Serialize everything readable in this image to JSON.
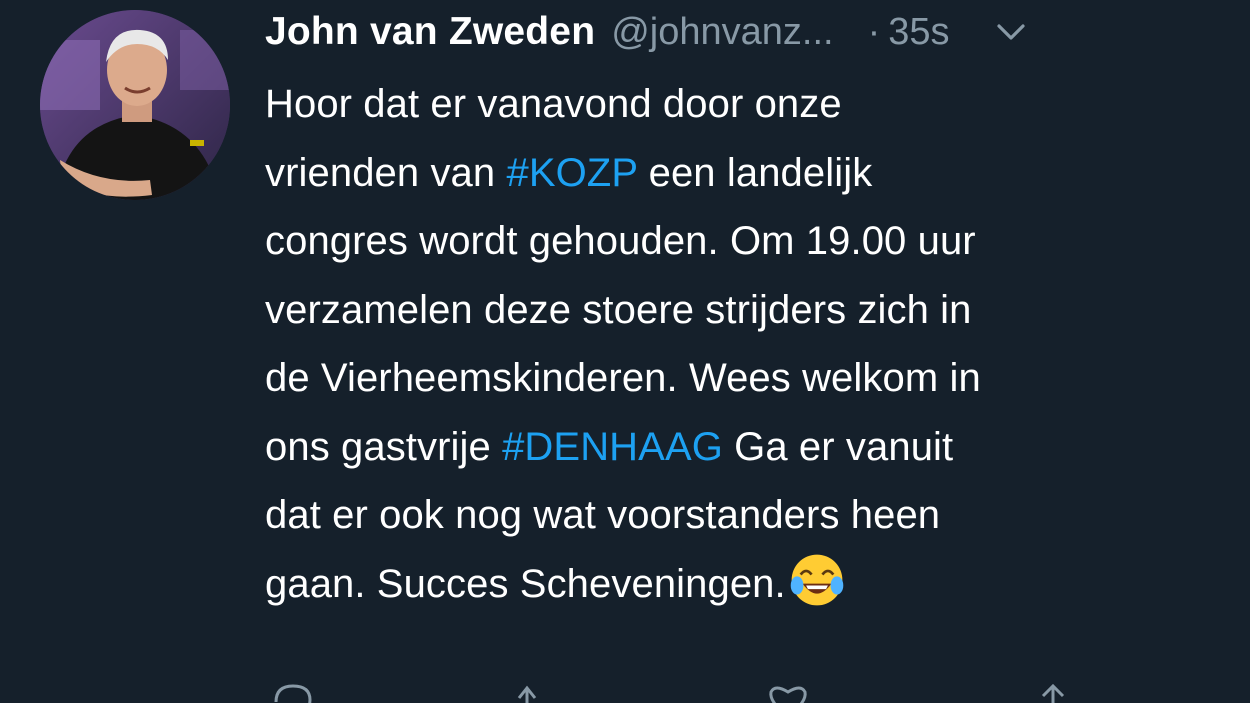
{
  "tweet": {
    "author_name": "John van Zweden",
    "author_handle": "@johnvanz...",
    "separator": "·",
    "timestamp": "35s",
    "lines": [
      [
        "Hoor dat er vanavond door onze"
      ],
      [
        "vrienden van ",
        {
          "hashtag": "#KOZP"
        },
        " een landelijk"
      ],
      [
        "congres wordt gehouden. Om 19.00 uur"
      ],
      [
        "verzamelen deze stoere strijders zich in"
      ],
      [
        "de Vierheemskinderen. Wees welkom in"
      ],
      [
        "ons gastvrije ",
        {
          "hashtag": "#DENHAAG"
        },
        " Ga er vanuit"
      ],
      [
        "dat er ook nog wat voorstanders heen"
      ],
      [
        "gaan. Succes Scheveningen.",
        {
          "emoji": "face-with-tears-of-joy"
        }
      ]
    ],
    "icons": {
      "menu": "chevron-down-icon",
      "reply": "reply-icon",
      "retweet": "retweet-icon",
      "like": "heart-icon",
      "share": "share-icon"
    }
  },
  "colors": {
    "background": "#15202b",
    "text": "#ffffff",
    "secondary_text": "#8899a6",
    "hashtag": "#1da1f2"
  }
}
